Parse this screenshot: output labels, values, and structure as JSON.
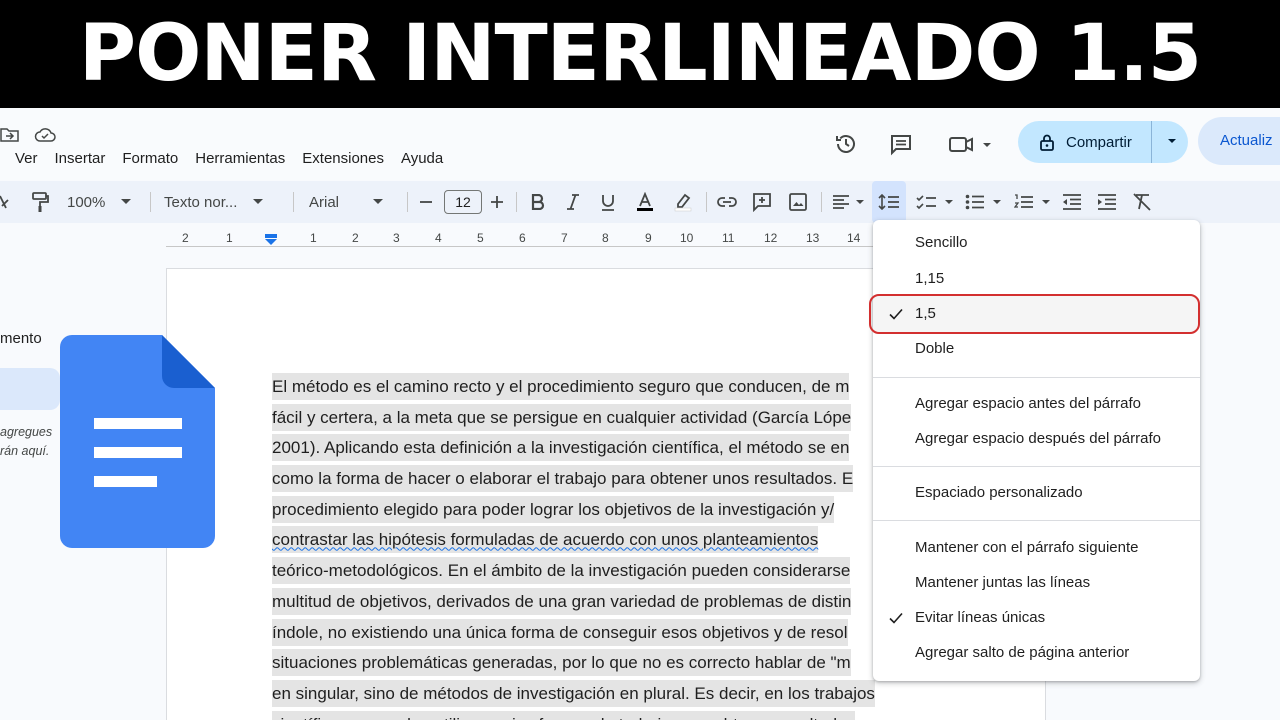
{
  "banner": {
    "title": "PONER INTERLINEADO 1.5"
  },
  "menubar": {
    "items": [
      "Ver",
      "Insertar",
      "Formato",
      "Herramientas",
      "Extensiones",
      "Ayuda"
    ]
  },
  "header": {
    "share_label": "Compartir",
    "update_label": "Actualiz",
    "icons": [
      "history-icon",
      "comment-icon",
      "meet-icon"
    ]
  },
  "toolbar": {
    "zoom": "100%",
    "style": "Texto nor...",
    "font": "Arial",
    "font_size": "12"
  },
  "ruler": {
    "numbers": [
      "2",
      "1",
      "1",
      "1",
      "2",
      "3",
      "4",
      "5",
      "6",
      "7",
      "8",
      "9",
      "10",
      "11",
      "12",
      "13",
      "14"
    ]
  },
  "outline": {
    "label": "mento",
    "hint_line1": "agregues",
    "hint_line2": "rán aquí."
  },
  "document": {
    "lines": [
      "El método es el camino recto y el procedimiento seguro que conducen, de m",
      "fácil y certera, a la meta que se persigue en cualquier actividad (García Lópe",
      "2001). Aplicando esta definición a la investigación científica, el método se en",
      "como la forma de hacer o elaborar el trabajo para obtener unos resultados. E",
      "procedimiento elegido para poder lograr los objetivos de la investigación y/",
      "contrastar las hipótesis formuladas de acuerdo con unos planteamientos",
      "teórico-metodológicos. En el ámbito de la investigación pueden considerarse",
      "multitud de objetivos, derivados de una gran variedad de problemas de distin",
      "índole, no existiendo una única forma de conseguir esos objetivos y de resol",
      "situaciones problemáticas generadas, por lo que no es correcto hablar de \"m",
      "en singular, sino de métodos de investigación en plural. Es decir, en los trabajos",
      "científicos, se suelen utilizar varias formas de trabajo para obtener resultados"
    ]
  },
  "spacing_menu": {
    "options": [
      {
        "label": "Sencillo",
        "checked": false
      },
      {
        "label": "1,15",
        "checked": false
      },
      {
        "label": "1,5",
        "checked": true
      },
      {
        "label": "Doble",
        "checked": false
      }
    ],
    "paragraph_items": [
      "Agregar espacio antes del párrafo",
      "Agregar espacio después del párrafo"
    ],
    "custom_item": "Espaciado personalizado",
    "pagination_items": [
      {
        "label": "Mantener con el párrafo siguiente",
        "checked": false
      },
      {
        "label": "Mantener juntas las líneas",
        "checked": false
      },
      {
        "label": "Evitar líneas únicas",
        "checked": true
      },
      {
        "label": "Agregar salto de página anterior",
        "checked": false
      }
    ]
  },
  "colors": {
    "accent": "#1a73e8",
    "share_bg": "#c2e7ff",
    "highlight_ring": "#d32f2f",
    "logo_blue": "#4285f4"
  }
}
